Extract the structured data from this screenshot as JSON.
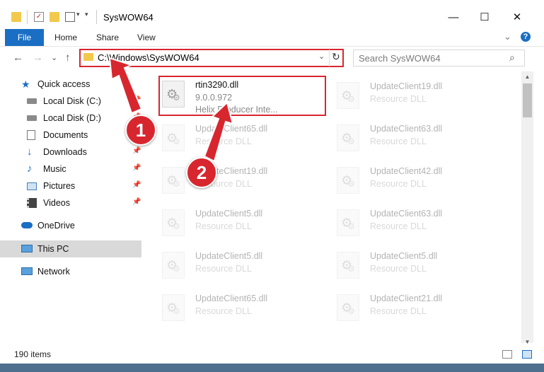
{
  "window": {
    "title": "SysWOW64",
    "minimize": "—",
    "maximize": "☐",
    "close": "✕"
  },
  "ribbon": {
    "tabs": [
      "File",
      "Home",
      "Share",
      "View"
    ],
    "help": "?"
  },
  "navigation": {
    "back": "←",
    "forward": "→",
    "recent": "⌄",
    "up": "↑",
    "address": "C:\\Windows\\SysWOW64",
    "search_placeholder": "Search SysWOW64"
  },
  "sidebar": {
    "items": [
      {
        "label": "Quick access",
        "icon": "star-icon",
        "pinned": false
      },
      {
        "label": "Local Disk (C:)",
        "icon": "drive-icon",
        "pinned": true
      },
      {
        "label": "Local Disk (D:)",
        "icon": "drive-icon",
        "pinned": true
      },
      {
        "label": "Documents",
        "icon": "documents-icon",
        "pinned": true
      },
      {
        "label": "Downloads",
        "icon": "download-icon",
        "pinned": true
      },
      {
        "label": "Music",
        "icon": "music-icon",
        "pinned": true
      },
      {
        "label": "Pictures",
        "icon": "pictures-icon",
        "pinned": true
      },
      {
        "label": "Videos",
        "icon": "videos-icon",
        "pinned": true
      },
      {
        "label": "OneDrive",
        "icon": "cloud-icon",
        "pinned": false
      },
      {
        "label": "This PC",
        "icon": "computer-icon",
        "pinned": false,
        "selected": true
      },
      {
        "label": "Network",
        "icon": "network-icon",
        "pinned": false
      }
    ]
  },
  "files": {
    "highlighted": {
      "name": "rtin3290.dll",
      "version": "9.0.0.972",
      "description": "Helix Producer Inte..."
    },
    "left_column": [
      {
        "name": "UpdateClient65.dll",
        "type": "Resource DLL"
      },
      {
        "name": "UpdateClient19.dll",
        "type": "Resource DLL"
      },
      {
        "name": "UpdateClient5.dll",
        "type": "Resource DLL"
      },
      {
        "name": "UpdateClient5.dll",
        "type": "Resource DLL"
      },
      {
        "name": "UpdateClient65.dll",
        "type": "Resource DLL"
      }
    ],
    "right_column": [
      {
        "name": "UpdateClient19.dll",
        "type": "Resource DLL"
      },
      {
        "name": "UpdateClient63.dll",
        "type": "Resource DLL"
      },
      {
        "name": "UpdateClient42.dll",
        "type": "Resource DLL"
      },
      {
        "name": "UpdateClient63.dll",
        "type": "Resource DLL"
      },
      {
        "name": "UpdateClient5.dll",
        "type": "Resource DLL"
      },
      {
        "name": "UpdateClient21.dll",
        "type": "Resource DLL"
      }
    ]
  },
  "status": {
    "item_count": "190 items"
  },
  "annotations": {
    "step1": "1",
    "step2": "2",
    "color": "#d8262f"
  }
}
